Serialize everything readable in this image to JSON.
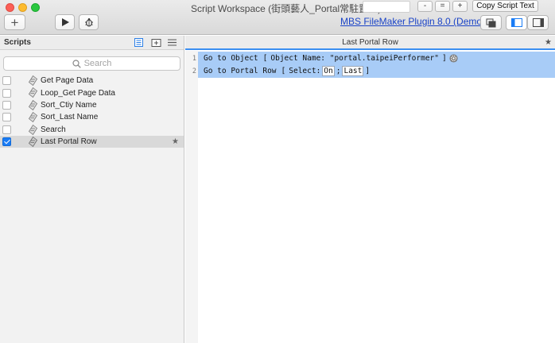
{
  "window": {
    "title": "Script Workspace (街頭藝人_Portal常駐置底)"
  },
  "toolbar": {
    "add_label": "+",
    "zoom_out": "-",
    "zoom_reset": "=",
    "zoom_in": "+",
    "copy_script_text": "Copy Script Text",
    "plugin_link": "MBS FileMaker Plugin 8.0 (Demo)"
  },
  "sidebar": {
    "title": "Scripts",
    "search_placeholder": "Search",
    "scripts": [
      {
        "name": "Get Page Data",
        "checked": false,
        "selected": false
      },
      {
        "name": "Loop_Get Page Data",
        "checked": false,
        "selected": false
      },
      {
        "name": "Sort_Ctiy Name",
        "checked": false,
        "selected": false
      },
      {
        "name": "Sort_Last Name",
        "checked": false,
        "selected": false
      },
      {
        "name": "Search",
        "checked": false,
        "selected": false
      },
      {
        "name": "Last Portal Row",
        "checked": true,
        "selected": true,
        "star": "★"
      }
    ]
  },
  "editor": {
    "title": "Last Portal Row",
    "star": "★",
    "lines": [
      {
        "num": "1",
        "step": "Go to Object",
        "open": "[",
        "param": "Object Name: \"portal.taipeiPerformer\"",
        "close": "]"
      },
      {
        "num": "2",
        "step": "Go to Portal Row",
        "open": "[",
        "select_label": "Select:",
        "select_value": "On",
        "sep": ";",
        "row_value": "Last",
        "close": "]"
      }
    ]
  },
  "colors": {
    "selection_blue": "#a8ccf7",
    "accent": "#3b8ff1",
    "checkbox": "#1a7cf5",
    "link": "#1a43c7"
  }
}
